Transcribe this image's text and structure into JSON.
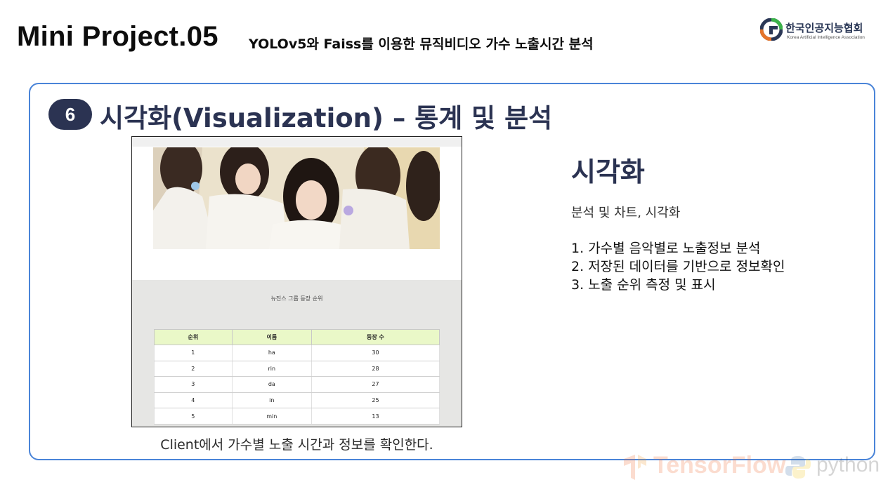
{
  "header": {
    "title": "Mini Project.05",
    "subtitle": "YOLOv5와 Faiss를 이용한 뮤직비디오 가수 노출시간 분석",
    "logo_name": "한국인공지능협회",
    "logo_en": "Korea Artificial Intelligence Association"
  },
  "section": {
    "number": "6",
    "title": "시각화(Visualization) – 통계 및 분석"
  },
  "screenshot": {
    "panel_title": "뉴진스 그룹 등장 순위",
    "table": {
      "headers": [
        "순위",
        "이름",
        "등장 수"
      ],
      "rows": [
        [
          "1",
          "ha",
          "30"
        ],
        [
          "2",
          "rin",
          "28"
        ],
        [
          "3",
          "da",
          "27"
        ],
        [
          "4",
          "in",
          "25"
        ],
        [
          "5",
          "min",
          "13"
        ]
      ]
    }
  },
  "caption": "Client에서 가수별 노출 시간과 정보를 확인한다.",
  "right": {
    "title": "시각화",
    "subtitle": "분석 및 차트, 시각화",
    "items": [
      "1. 가수별 음악별로 노출정보 분석",
      "2. 저장된 데이터를 기반으로 정보확인",
      "3. 노출 순위 측정 및 표시"
    ]
  },
  "watermark": {
    "tensorflow": "TensorFlow",
    "python": "python"
  },
  "icons": {
    "logo": "kaia-logo-icon",
    "tensorflow": "tensorflow-icon",
    "python": "python-icon"
  },
  "colors": {
    "accent": "#2b3352",
    "card_border": "#4a84d8",
    "table_header": "#eaf8c8",
    "panel_bg": "#e6e6e4"
  }
}
